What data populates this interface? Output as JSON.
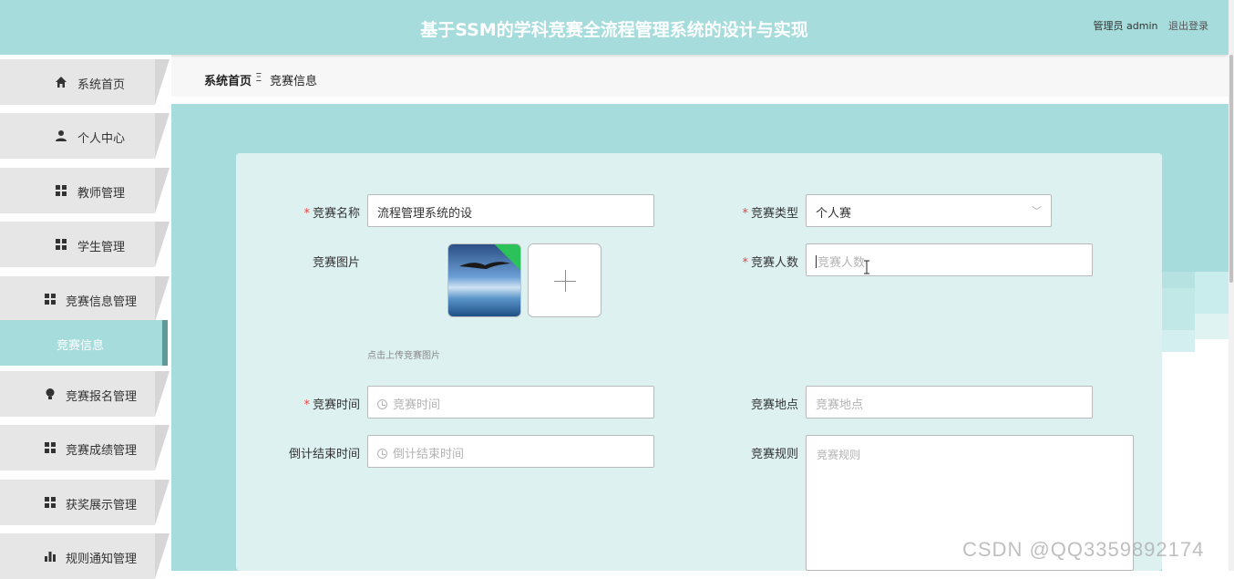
{
  "header": {
    "title": "基于SSM的学科竞赛全流程管理系统的设计与实现",
    "user_label": "管理员 admin",
    "logout_label": "退出登录"
  },
  "sidebar": {
    "items": [
      {
        "label": "系统首页",
        "icon": "home-icon"
      },
      {
        "label": "个人中心",
        "icon": "user-icon"
      },
      {
        "label": "教师管理",
        "icon": "grid-icon"
      },
      {
        "label": "学生管理",
        "icon": "grid-icon"
      },
      {
        "label": "竞赛信息管理",
        "icon": "grid-icon"
      },
      {
        "label": "竞赛信息",
        "icon": ""
      },
      {
        "label": "竞赛报名管理",
        "icon": "bulb-icon"
      },
      {
        "label": "竞赛成绩管理",
        "icon": "grid-icon"
      },
      {
        "label": "获奖展示管理",
        "icon": "grid-icon"
      },
      {
        "label": "规则通知管理",
        "icon": "bar-chart-icon"
      }
    ]
  },
  "breadcrumb": {
    "home": "系统首页",
    "separator": "Ξ",
    "current": "竞赛信息"
  },
  "form": {
    "name": {
      "label": "竞赛名称",
      "value": "流程管理系统的设"
    },
    "type": {
      "label": "竞赛类型",
      "value": "个人赛"
    },
    "image": {
      "label": "竞赛图片",
      "hint": "点击上传竞赛图片"
    },
    "count": {
      "label": "竞赛人数",
      "placeholder": "竞赛人数"
    },
    "time": {
      "label": "竞赛时间",
      "placeholder": "竞赛时间"
    },
    "place": {
      "label": "竞赛地点",
      "placeholder": "竞赛地点"
    },
    "end_time": {
      "label": "倒计结束时间",
      "placeholder": "倒计结束时间"
    },
    "rules": {
      "label": "竞赛规则",
      "placeholder": "竞赛规则"
    }
  },
  "watermark": "CSDN @QQ3359892174",
  "colors": {
    "accent": "#a6dcdc",
    "card": "#dcf1f0",
    "required": "#e64545"
  }
}
